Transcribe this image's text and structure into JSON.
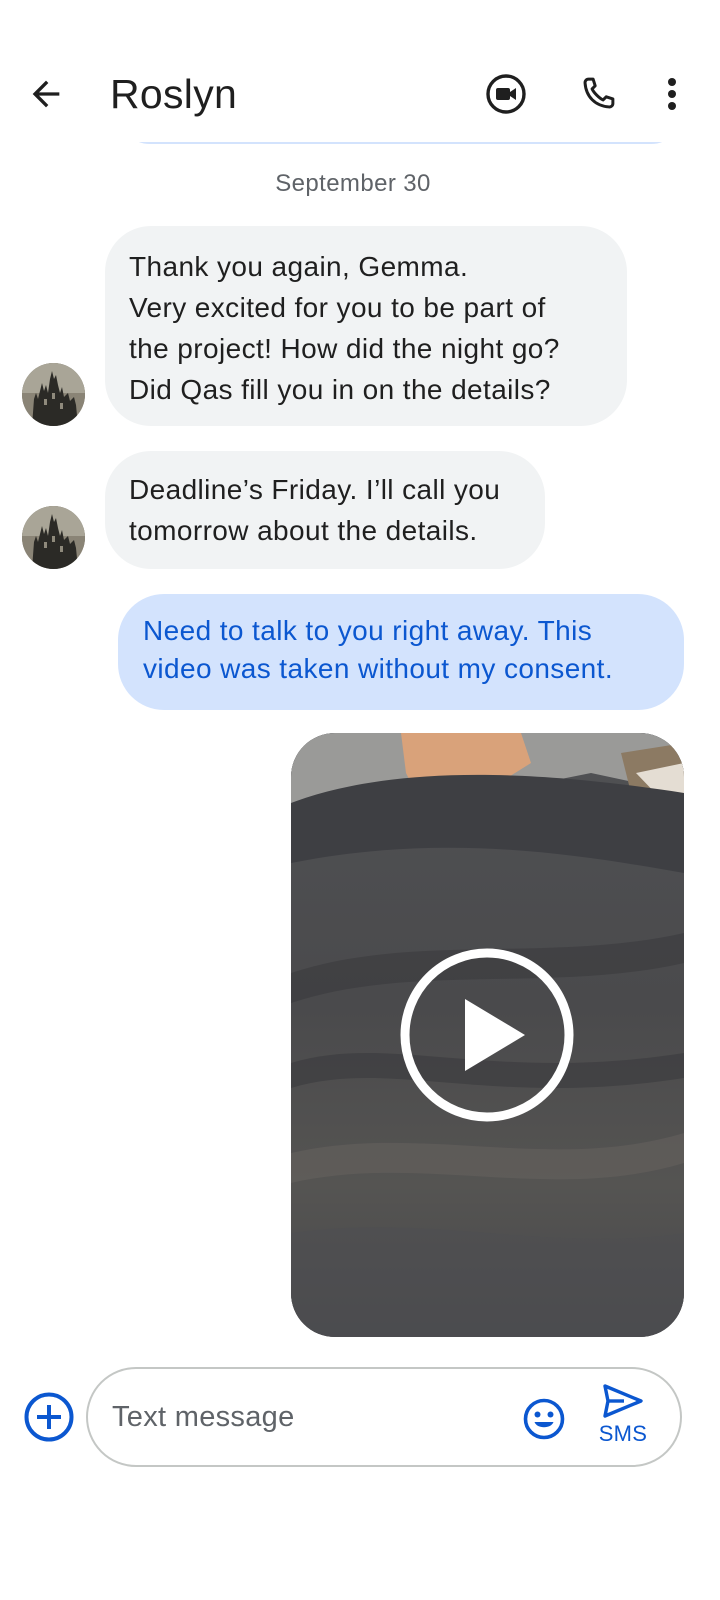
{
  "header": {
    "contact_name": "Roslyn"
  },
  "conversation": {
    "date_divider": "September 30",
    "messages": [
      {
        "direction": "incoming",
        "lines": [
          "Thank you again, Gemma.",
          "Very excited for you to be part of",
          "the project! How did the night go?",
          "Did Qas fill you in on the details?"
        ]
      },
      {
        "direction": "incoming",
        "lines": [
          "Deadline’s Friday. I’ll call you",
          "tomorrow about the details."
        ]
      },
      {
        "direction": "outgoing",
        "lines": [
          "Need to talk to you right away. This",
          "video was taken without my consent."
        ]
      },
      {
        "direction": "outgoing",
        "type": "video",
        "icon": "play-icon"
      }
    ]
  },
  "compose": {
    "placeholder": "Text message",
    "value": "",
    "send_label": "SMS"
  },
  "icons": {
    "back": "back-arrow-icon",
    "video_call": "video-call-icon",
    "phone": "phone-icon",
    "more": "more-vert-icon",
    "add": "add-circle-icon",
    "emoji": "emoji-icon",
    "send": "send-icon"
  },
  "colors": {
    "accent": "#0b57d0",
    "outgoing_bubble": "#d3e3fd",
    "incoming_bubble": "#f1f3f4",
    "secondary_text": "#5f6368"
  }
}
